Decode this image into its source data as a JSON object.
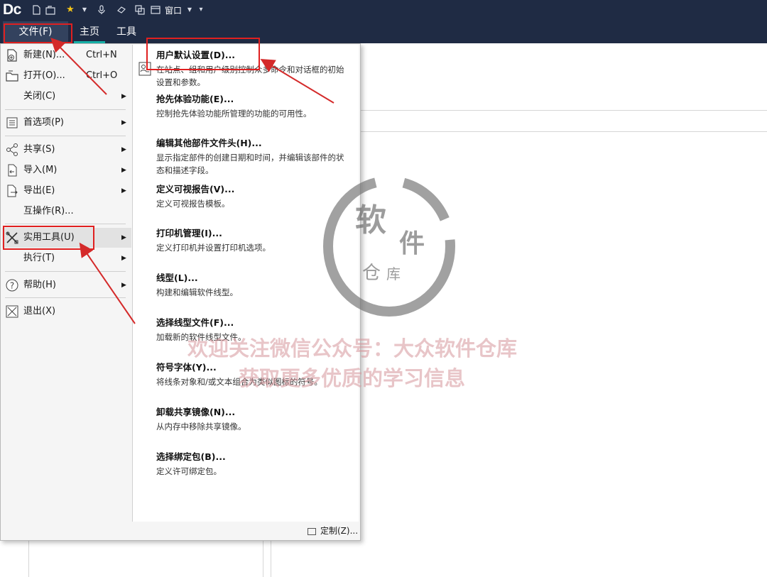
{
  "app": {
    "logo": "Dc",
    "window_menu": "窗口"
  },
  "menubar": {
    "file": "文件(F)",
    "home": "主页",
    "tools": "工具"
  },
  "file_menu": {
    "items": [
      {
        "label": "新建(N)...",
        "shortcut": "Ctrl+N",
        "icon": "new-document-icon"
      },
      {
        "label": "打开(O)...",
        "shortcut": "Ctrl+O",
        "icon": "open-folder-icon"
      },
      {
        "label": "关闭(C)",
        "icon": ""
      },
      {
        "label": "首选项(P)",
        "icon": "preferences-icon"
      },
      {
        "label": "共享(S)",
        "icon": "share-icon"
      },
      {
        "label": "导入(M)",
        "icon": "import-icon"
      },
      {
        "label": "导出(E)",
        "icon": "export-icon"
      },
      {
        "label": "互操作(R)...",
        "icon": ""
      },
      {
        "label": "实用工具(U)",
        "icon": "utilities-tools-icon"
      },
      {
        "label": "执行(T)",
        "icon": ""
      },
      {
        "label": "帮助(H)",
        "icon": "help-icon"
      },
      {
        "label": "退出(X)",
        "icon": "exit-icon"
      }
    ]
  },
  "submenu": {
    "items": [
      {
        "title": "用户默认设置(D)...",
        "desc": "在站点、组和用户级别控制众多命令和对话框的初始设置和参数。"
      },
      {
        "title": "抢先体验功能(E)...",
        "desc": "控制抢先体验功能所管理的功能的可用性。"
      },
      {
        "title": "编辑其他部件文件头(H)...",
        "desc": "显示指定部件的创建日期和时间，并编辑该部件的状态和描述字段。"
      },
      {
        "title": "定义可视报告(V)...",
        "desc": "定义可视报告模板。"
      },
      {
        "title": "打印机管理(I)...",
        "desc": "定义打印机并设置打印机选项。"
      },
      {
        "title": "线型(L)...",
        "desc": "构建和编辑软件线型。"
      },
      {
        "title": "选择线型文件(F)...",
        "desc": "加载新的软件线型文件。"
      },
      {
        "title": "符号字体(Y)...",
        "desc": "将线条对象和/或文本组合为类似图标的符号。"
      },
      {
        "title": "卸载共享镜像(N)...",
        "desc": "从内存中移除共享镜像。"
      },
      {
        "title": "选择绑定包(B)...",
        "desc": "定义许可绑定包。"
      }
    ],
    "customize": "定制(Z)..."
  },
  "watermark": {
    "seal_char1": "软",
    "seal_char2": "件",
    "seal_char3": "仓",
    "seal_char4": "库",
    "line1": "欢迎关注微信公众号：大众软件仓库",
    "line2": "获取更多优质的学习信息"
  },
  "colors": {
    "titlebar": "#1f2b44",
    "accent": "#17b3a9",
    "highlight_box": "#e02020"
  }
}
